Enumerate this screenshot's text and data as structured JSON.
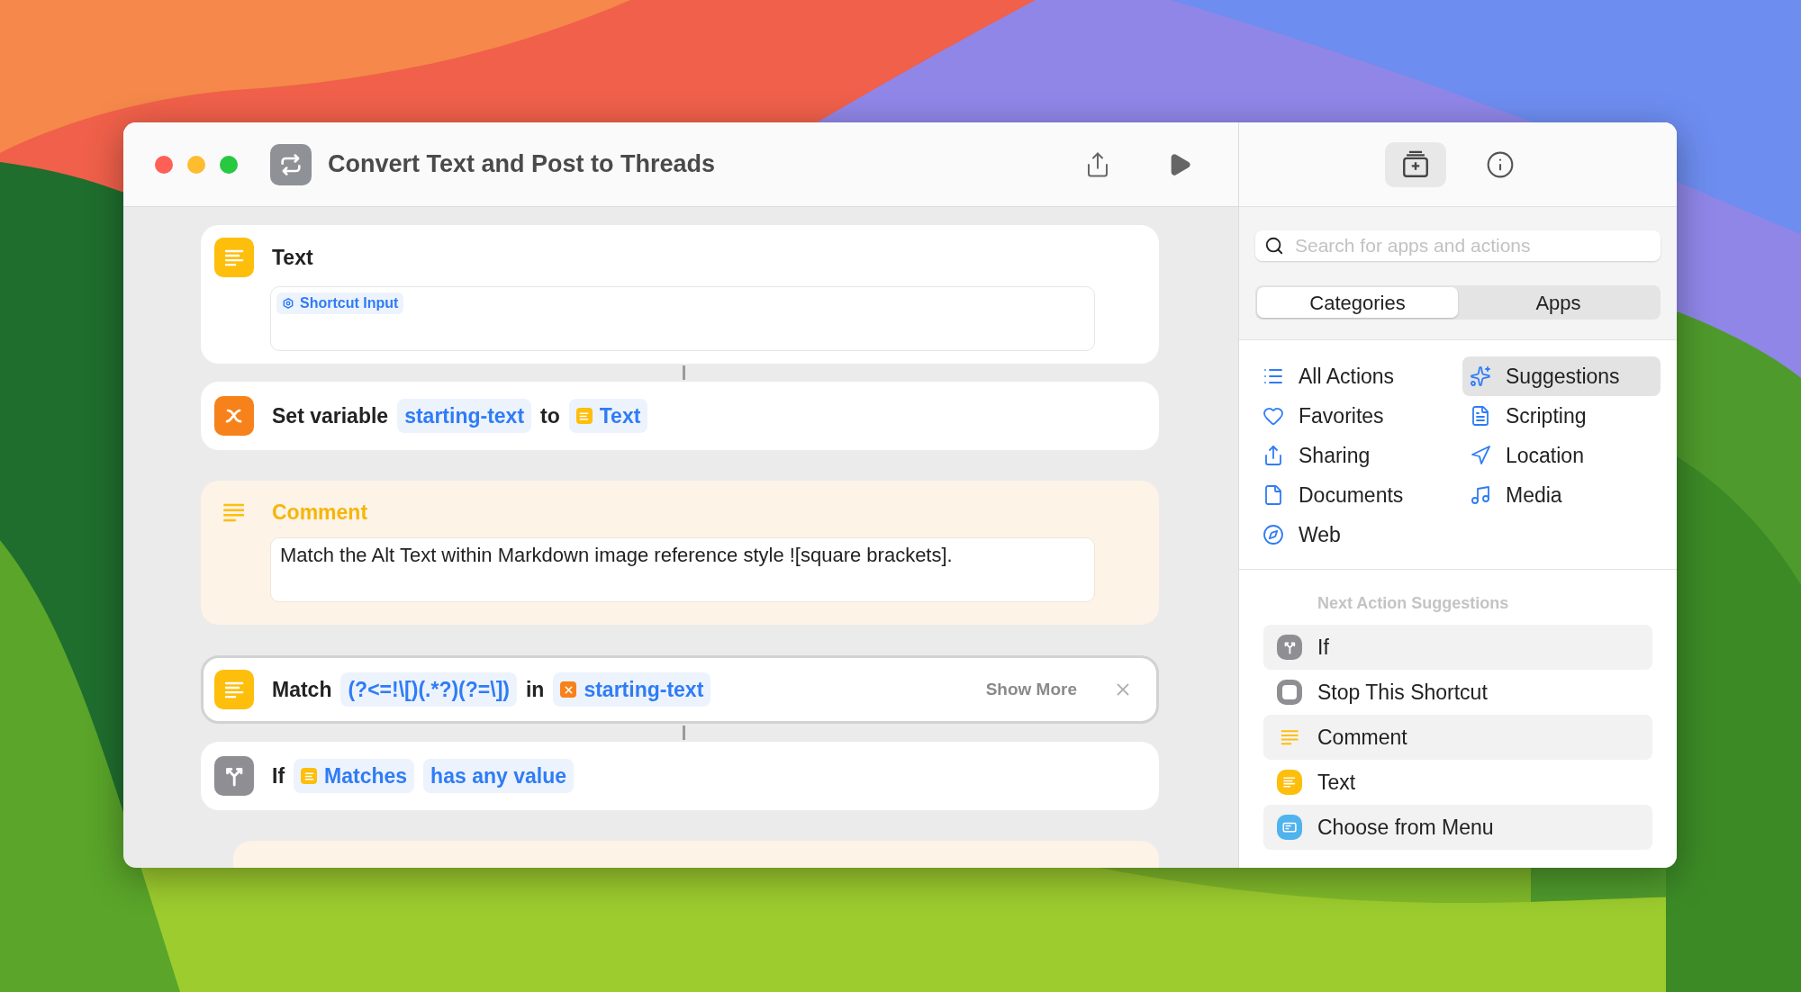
{
  "window": {
    "title": "Convert Text and Post to Threads"
  },
  "actions": [
    {
      "kind": "text_block",
      "title": "Text",
      "selected": false,
      "linked": false,
      "field_tokens": [
        "Shortcut Input"
      ]
    },
    {
      "kind": "set_variable",
      "selected": false,
      "linked": true,
      "parts": [
        {
          "kind": "label",
          "text": "Set variable"
        },
        {
          "kind": "token",
          "text": "starting-text"
        },
        {
          "kind": "label",
          "text": "to"
        },
        {
          "kind": "text_token",
          "text": "Text"
        }
      ]
    },
    {
      "kind": "comment",
      "title": "Comment",
      "selected": false,
      "linked": false,
      "body": "Match the Alt Text within Markdown image reference style ![square brackets]."
    },
    {
      "kind": "match",
      "selected": true,
      "linked": false,
      "parts": [
        {
          "kind": "label",
          "text": "Match"
        },
        {
          "kind": "token",
          "text": "(?<=!\\[)(.*?)(?=\\])"
        },
        {
          "kind": "label",
          "text": "in"
        },
        {
          "kind": "variable_token",
          "text": "starting-text"
        }
      ],
      "show_more": "Show More"
    },
    {
      "kind": "if",
      "selected": false,
      "linked": true,
      "parts": [
        {
          "kind": "label",
          "text": "If"
        },
        {
          "kind": "text_token",
          "text": "Matches"
        },
        {
          "kind": "token",
          "text": "has any value"
        }
      ]
    },
    {
      "kind": "comment_cut",
      "selected": false,
      "linked": false
    }
  ],
  "library": {
    "toolbar": [
      {
        "kind": "library",
        "selected": true
      },
      {
        "kind": "info",
        "selected": false
      }
    ],
    "search": {
      "placeholder": "Search for apps and actions"
    },
    "segments": [
      {
        "label": "Categories",
        "selected": true
      },
      {
        "label": "Apps",
        "selected": false
      }
    ],
    "categories": [
      {
        "kind": "list",
        "label": "All Actions",
        "selected": false
      },
      {
        "kind": "sparkles",
        "label": "Suggestions",
        "selected": true
      },
      {
        "kind": "heart",
        "label": "Favorites",
        "selected": false
      },
      {
        "kind": "scroll",
        "label": "Scripting",
        "selected": false
      },
      {
        "kind": "share",
        "label": "Sharing",
        "selected": false
      },
      {
        "kind": "location",
        "label": "Location",
        "selected": false
      },
      {
        "kind": "document",
        "label": "Documents",
        "selected": false
      },
      {
        "kind": "music",
        "label": "Media",
        "selected": false
      },
      {
        "kind": "compass",
        "label": "Web",
        "selected": false
      }
    ],
    "suggestions_heading": "Next Action Suggestions",
    "suggestions": [
      {
        "kind": "if",
        "label": "If"
      },
      {
        "kind": "stop",
        "label": "Stop This Shortcut"
      },
      {
        "kind": "comment",
        "label": "Comment"
      },
      {
        "kind": "text",
        "label": "Text"
      },
      {
        "kind": "menu",
        "label": "Choose from Menu"
      }
    ]
  }
}
